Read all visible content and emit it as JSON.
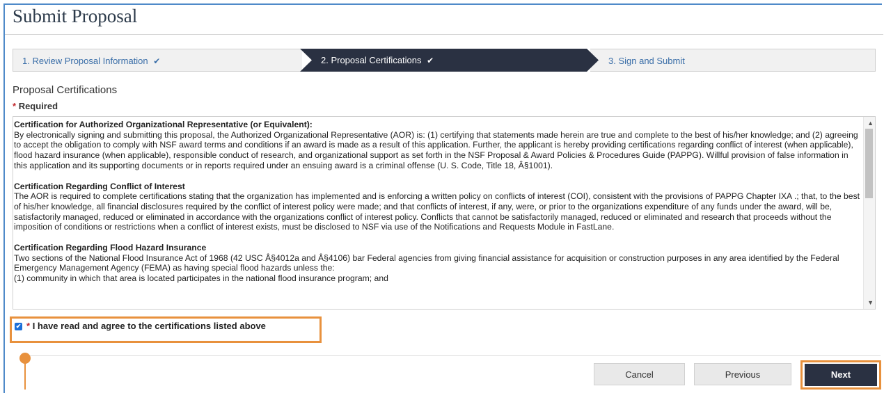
{
  "page": {
    "title": "Submit Proposal"
  },
  "stepper": {
    "steps": [
      {
        "label": "1. Review Proposal Information",
        "completed": true,
        "active": false
      },
      {
        "label": "2. Proposal Certifications",
        "completed": true,
        "active": true
      },
      {
        "label": "3. Sign and Submit",
        "completed": false,
        "active": false
      }
    ],
    "check_glyph": "✔",
    "colors": {
      "active_bg": "#2a3142",
      "inactive_bg": "#f1f1f1",
      "link_text": "#3a6ea8"
    }
  },
  "section": {
    "heading": "Proposal Certifications",
    "required_star": "*",
    "required_label": "Required"
  },
  "certifications": [
    {
      "heading": "Certification for Authorized Organizational Representative (or Equivalent):",
      "body": "By electronically signing and submitting this proposal, the Authorized Organizational Representative (AOR) is: (1) certifying that statements made herein are true and complete to the best of his/her knowledge; and (2) agreeing to accept the obligation to comply with NSF award terms and conditions if an award is made as a result of this application. Further, the applicant is hereby providing certifications regarding conflict of interest (when applicable), flood hazard insurance (when applicable), responsible conduct of research, and organizational support as set forth in the NSF Proposal & Award Policies & Procedures Guide (PAPPG). Willful provision of false information in this application and its supporting documents or in reports required under an ensuing award is a criminal offense (U. S. Code, Title 18, Â§1001)."
    },
    {
      "heading": "Certification Regarding Conflict of Interest",
      "body": "The AOR is required to complete certifications stating that the organization has implemented and is enforcing a written policy on conflicts of interest (COI), consistent with the provisions of PAPPG Chapter IXA .; that, to the best of his/her knowledge, all financial disclosures required by the conflict of interest policy were made; and that conflicts of interest, if any, were, or prior to the organizations expenditure of any funds under the award, will be, satisfactorily managed, reduced or eliminated in accordance with the organizations conflict of interest policy. Conflicts that cannot be satisfactorily managed, reduced or eliminated and research that proceeds without the imposition of conditions or restrictions when a conflict of interest exists, must be disclosed to NSF via use of the Notifications and Requests Module in FastLane."
    },
    {
      "heading": "Certification Regarding Flood Hazard Insurance",
      "body": "Two sections of the National Flood Insurance Act of 1968 (42 USC Â§4012a and Â§4106) bar Federal agencies from giving financial assistance for acquisition or construction purposes in any area identified by the Federal Emergency Management Agency (FEMA) as having special flood hazards unless the:",
      "extra": "(1) community in which that area is located participates in the national flood insurance program; and"
    }
  ],
  "scroll": {
    "up_glyph": "▲",
    "down_glyph": "▼"
  },
  "agreement": {
    "checked": true,
    "check_glyph": "✔",
    "required_star": "*",
    "label": "I have read and agree to the certifications listed above"
  },
  "buttons": {
    "cancel": "Cancel",
    "previous": "Previous",
    "next": "Next"
  },
  "colors": {
    "highlight": "#e8913d",
    "primary_button": "#2a3142",
    "required_star": "#c0282d"
  }
}
